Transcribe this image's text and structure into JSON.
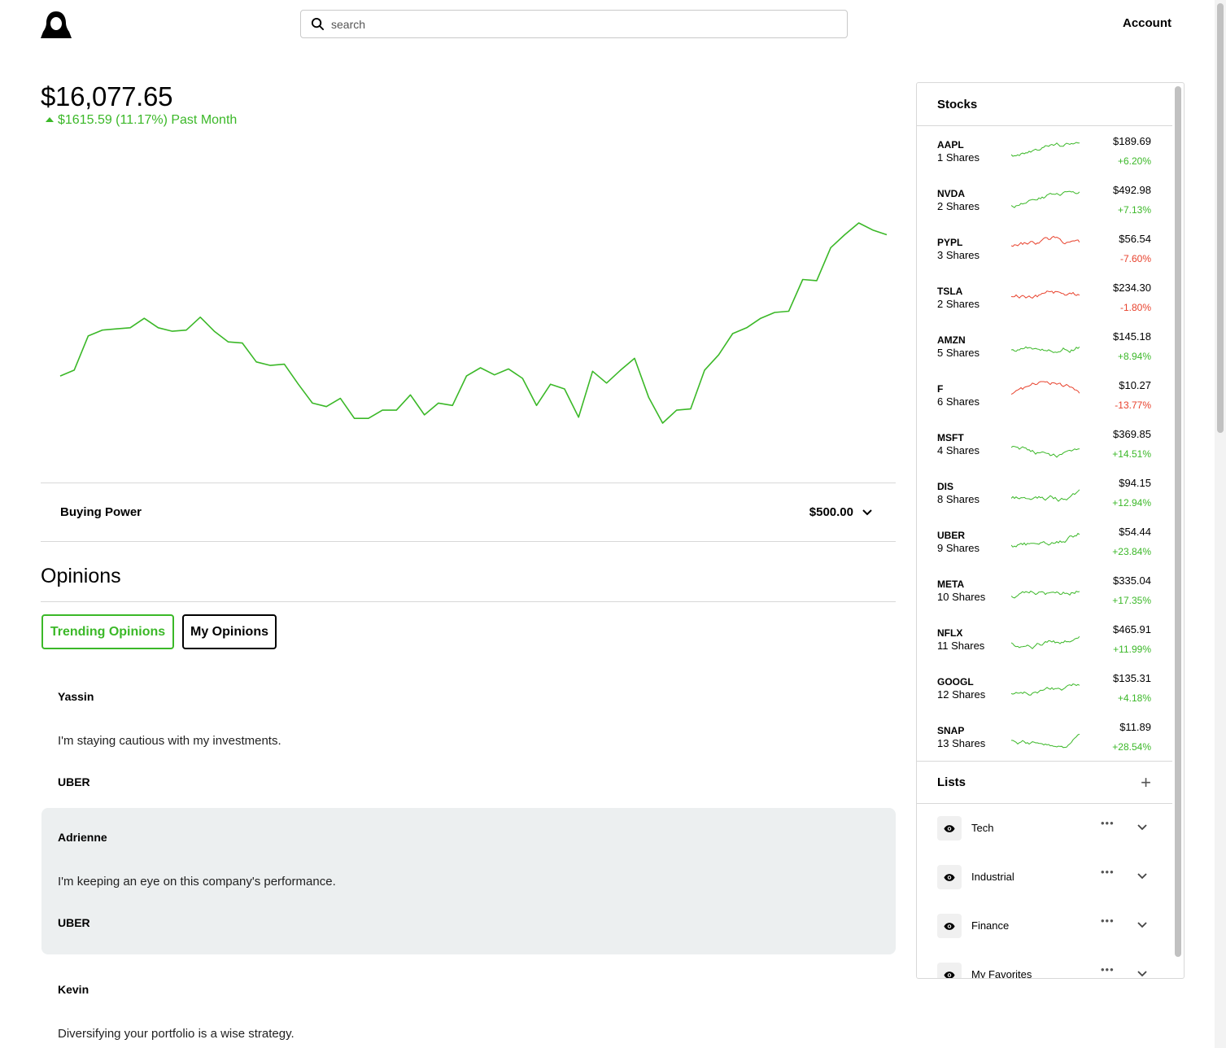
{
  "header": {
    "search_placeholder": "search",
    "account_label": "Account"
  },
  "portfolio": {
    "value": "$16,077.65",
    "change_text": "$1615.59 (11.17%) Past Month",
    "accent_color": "#3bb828",
    "negative_color": "#e8412c"
  },
  "chart_data": {
    "type": "line",
    "title": "",
    "xlabel": "",
    "ylabel": "",
    "grid": false,
    "legend": "none",
    "ylim": [
      0,
      100
    ],
    "x": [
      1,
      2,
      3,
      4,
      5,
      6,
      7,
      8,
      9,
      10,
      11,
      12,
      13,
      14,
      15,
      16,
      17,
      18,
      19,
      20,
      21,
      22,
      23,
      24,
      25,
      26,
      27,
      28,
      29,
      30,
      31,
      32,
      33,
      34,
      35,
      36,
      37,
      38,
      39,
      40,
      41,
      42,
      43,
      44,
      45,
      46,
      47,
      48,
      49,
      50,
      51,
      52,
      53,
      54,
      55,
      56,
      57,
      58,
      59,
      60,
      61,
      62,
      63,
      64
    ],
    "series": [
      {
        "values": [
          40,
          45,
          74,
          79,
          80,
          81,
          89,
          81,
          78,
          79,
          90,
          78,
          69,
          68,
          52,
          49,
          50,
          33,
          17,
          14,
          21,
          4,
          4,
          11,
          11,
          24,
          7,
          17,
          15,
          40,
          47,
          41,
          46,
          38,
          15,
          33,
          29,
          5,
          44,
          34,
          45,
          55,
          22,
          0,
          11,
          12,
          45,
          58,
          76,
          81,
          89,
          94,
          95,
          122,
          121,
          149,
          160,
          170,
          164,
          160
        ]
      }
    ]
  },
  "buying_power": {
    "label": "Buying Power",
    "value": "$500.00"
  },
  "opinions": {
    "title": "Opinions",
    "tabs": [
      {
        "label": "Trending Opinions",
        "active": true
      },
      {
        "label": "My Opinions",
        "active": false
      }
    ],
    "items": [
      {
        "author": "Yassin",
        "text": "I'm staying cautious with my investments.",
        "ticker": "UBER"
      },
      {
        "author": "Adrienne",
        "text": "I'm keeping an eye on this company's performance.",
        "ticker": "UBER"
      },
      {
        "author": "Kevin",
        "text": "Diversifying your portfolio is a wise strategy.",
        "ticker": ""
      }
    ]
  },
  "stocks": {
    "title": "Stocks",
    "items": [
      {
        "symbol": "AAPL",
        "shares": "1 Shares",
        "price": "$189.69",
        "change": "+6.20%",
        "trend": "up"
      },
      {
        "symbol": "NVDA",
        "shares": "2 Shares",
        "price": "$492.98",
        "change": "+7.13%",
        "trend": "up"
      },
      {
        "symbol": "PYPL",
        "shares": "3 Shares",
        "price": "$56.54",
        "change": "-7.60%",
        "trend": "down"
      },
      {
        "symbol": "TSLA",
        "shares": "2 Shares",
        "price": "$234.30",
        "change": "-1.80%",
        "trend": "down"
      },
      {
        "symbol": "AMZN",
        "shares": "5 Shares",
        "price": "$145.18",
        "change": "+8.94%",
        "trend": "up"
      },
      {
        "symbol": "F",
        "shares": "6 Shares",
        "price": "$10.27",
        "change": "-13.77%",
        "trend": "down"
      },
      {
        "symbol": "MSFT",
        "shares": "4 Shares",
        "price": "$369.85",
        "change": "+14.51%",
        "trend": "up"
      },
      {
        "symbol": "DIS",
        "shares": "8 Shares",
        "price": "$94.15",
        "change": "+12.94%",
        "trend": "up"
      },
      {
        "symbol": "UBER",
        "shares": "9 Shares",
        "price": "$54.44",
        "change": "+23.84%",
        "trend": "up"
      },
      {
        "symbol": "META",
        "shares": "10 Shares",
        "price": "$335.04",
        "change": "+17.35%",
        "trend": "up"
      },
      {
        "symbol": "NFLX",
        "shares": "11 Shares",
        "price": "$465.91",
        "change": "+11.99%",
        "trend": "up"
      },
      {
        "symbol": "GOOGL",
        "shares": "12 Shares",
        "price": "$135.31",
        "change": "+4.18%",
        "trend": "up"
      },
      {
        "symbol": "SNAP",
        "shares": "13 Shares",
        "price": "$11.89",
        "change": "+28.54%",
        "trend": "up"
      }
    ]
  },
  "lists": {
    "title": "Lists",
    "items": [
      {
        "name": "Tech",
        "icon": "eye-icon"
      },
      {
        "name": "Industrial",
        "icon": "eye-icon"
      },
      {
        "name": "Finance",
        "icon": "eye-icon"
      },
      {
        "name": "My Favorites",
        "icon": "eye-icon"
      }
    ]
  }
}
